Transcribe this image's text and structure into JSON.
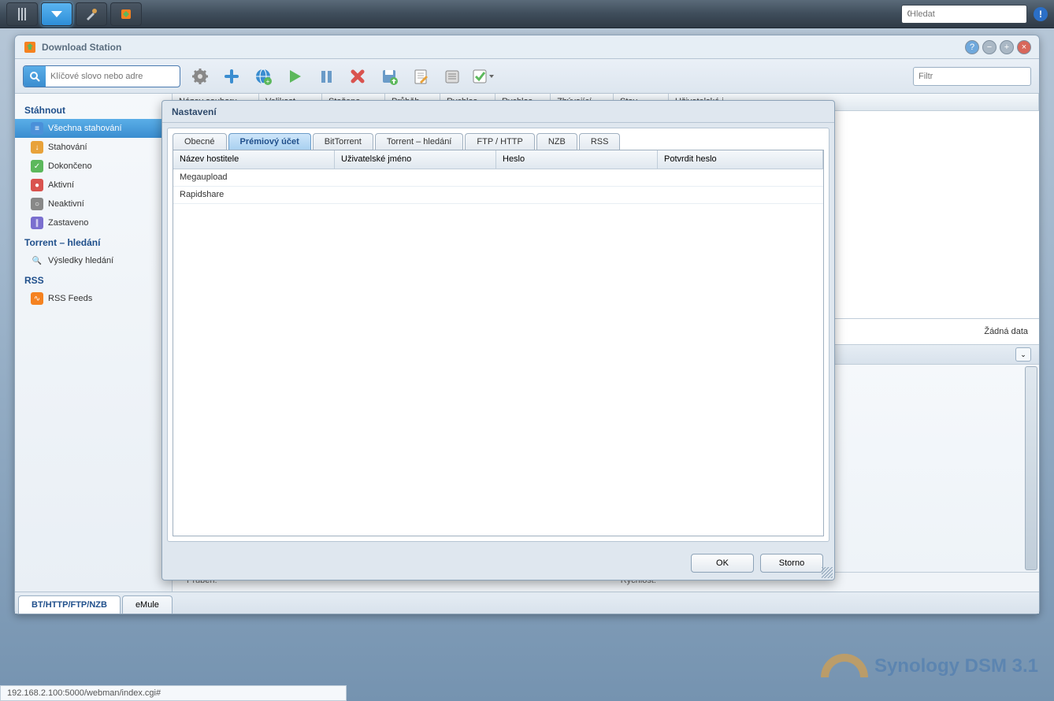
{
  "taskbar": {
    "search_placeholder": "Hledat"
  },
  "window": {
    "title": "Download Station",
    "search_placeholder": "Klíčové slovo nebo adre",
    "filter_placeholder": "Filtr"
  },
  "sidebar": {
    "sections": [
      {
        "label": "Stáhnout"
      },
      {
        "label": "Torrent – hledání"
      },
      {
        "label": "RSS"
      }
    ],
    "download_items": [
      {
        "label": "Všechna stahování"
      },
      {
        "label": "Stahování"
      },
      {
        "label": "Dokončeno"
      },
      {
        "label": "Aktivní"
      },
      {
        "label": "Neaktivní"
      },
      {
        "label": "Zastaveno"
      }
    ],
    "torrent_items": [
      {
        "label": "Výsledky hledání"
      }
    ],
    "rss_items": [
      {
        "label": "RSS Feeds"
      }
    ]
  },
  "grid": {
    "columns": [
      "Název souboru",
      "Velikost",
      "Staženo",
      "Průběh",
      "Rychlos",
      "Rychlos",
      "Zbývající",
      "Stav",
      "Uživatelské j"
    ],
    "no_data": "Žádná data"
  },
  "bottom_info": {
    "left": "Průběh:",
    "right": "Rychlost:"
  },
  "bottom_tabs": [
    {
      "label": "BT/HTTP/FTP/NZB"
    },
    {
      "label": "eMule"
    }
  ],
  "dialog": {
    "title": "Nastavení",
    "tabs": [
      "Obecné",
      "Prémiový účet",
      "BitTorrent",
      "Torrent – hledání",
      "FTP / HTTP",
      "NZB",
      "RSS"
    ],
    "columns": [
      "Název hostitele",
      "Uživatelské jméno",
      "Heslo",
      "Potvrdit heslo"
    ],
    "rows": [
      {
        "host": "Megaupload",
        "user": "",
        "pass": "",
        "confirm": ""
      },
      {
        "host": "Rapidshare",
        "user": "",
        "pass": "",
        "confirm": ""
      }
    ],
    "ok": "OK",
    "cancel": "Storno"
  },
  "status": "192.168.2.100:5000/webman/index.cgi#",
  "watermark": "Synology DSM 3.1"
}
